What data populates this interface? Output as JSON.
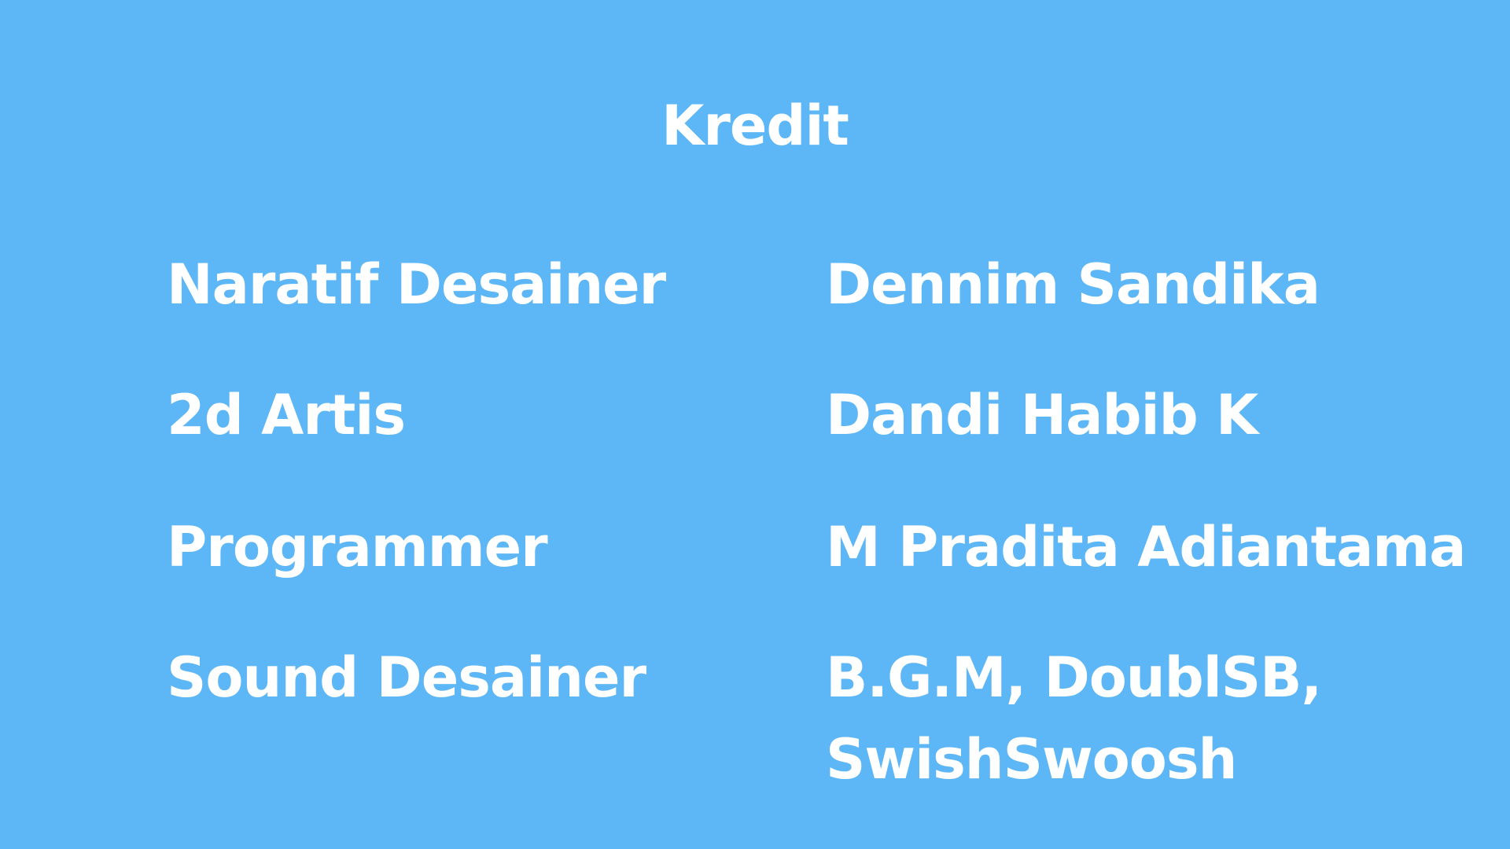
{
  "screen": {
    "background_color": "#5db6f5",
    "text_color": "#ffffff",
    "title": "Kredit"
  },
  "credits": [
    {
      "role": "Naratif Desainer",
      "names": [
        "Dennim Sandika"
      ]
    },
    {
      "role": "2d Artis",
      "names": [
        "Dandi Habib K"
      ]
    },
    {
      "role": "Programmer",
      "names": [
        "M Pradita Adiantama"
      ]
    },
    {
      "role": "Sound Desainer",
      "names": [
        "B.G.M, DoublSB,",
        "SwishSwoosh"
      ]
    }
  ]
}
